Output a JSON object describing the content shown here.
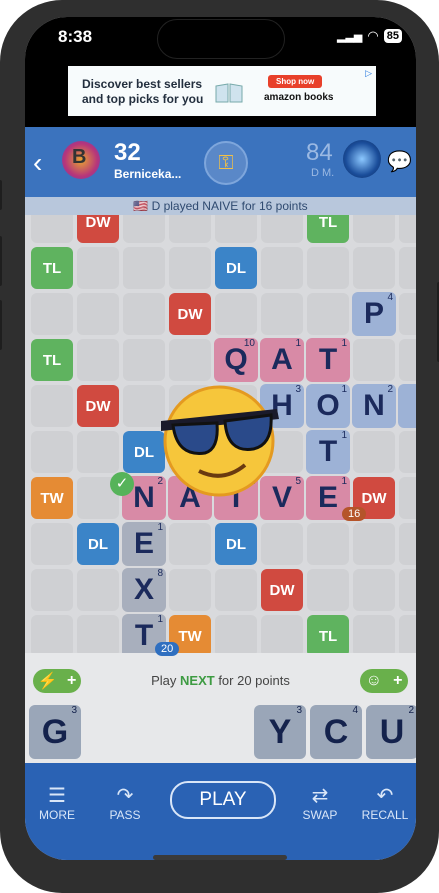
{
  "status": {
    "time": "8:38",
    "battery": "85"
  },
  "ad": {
    "headline": "Discover best sellers and top picks for you",
    "button": "Shop now",
    "brand": "amazon books"
  },
  "header": {
    "left_initial": "B",
    "left_score": "32",
    "left_name": "Berniceka...",
    "right_score": "84",
    "right_name": "D M."
  },
  "last_move": "🇺🇸 D played NAIVE for 16 points",
  "board": {
    "premium_labels": {
      "tl": "TL",
      "dl": "DL",
      "dw": "DW",
      "tw": "TW"
    },
    "played_words": [
      "QAT",
      "HONI",
      "NAIVE",
      "EXT"
    ],
    "tiles": [
      {
        "letter": "Q",
        "points": "10"
      },
      {
        "letter": "A",
        "points": "1"
      },
      {
        "letter": "T",
        "points": "1"
      },
      {
        "letter": "H",
        "points": "3"
      },
      {
        "letter": "O",
        "points": "1"
      },
      {
        "letter": "N",
        "points": "2"
      },
      {
        "letter": "I",
        "points": "1"
      },
      {
        "letter": "T",
        "points": "1"
      },
      {
        "letter": "N",
        "points": "2"
      },
      {
        "letter": "A",
        "points": "1"
      },
      {
        "letter": "I",
        "points": "1"
      },
      {
        "letter": "V",
        "points": "5"
      },
      {
        "letter": "E",
        "points": "1"
      },
      {
        "letter": "E",
        "points": "1"
      },
      {
        "letter": "X",
        "points": "8"
      },
      {
        "letter": "T",
        "points": "1"
      },
      {
        "letter": "P",
        "points": "4"
      }
    ],
    "move_score_badge": "16",
    "preview_score_badge": "20"
  },
  "hint": {
    "prefix": "Play ",
    "word": "NEXT",
    "suffix": " for 20 points"
  },
  "rack": [
    {
      "letter": "G",
      "points": "3"
    },
    {
      "letter": "Y",
      "points": "3"
    },
    {
      "letter": "C",
      "points": "4"
    },
    {
      "letter": "U",
      "points": "2"
    }
  ],
  "nav": {
    "more": "MORE",
    "pass": "PASS",
    "play": "PLAY",
    "swap": "SWAP",
    "recall": "RECALL"
  }
}
